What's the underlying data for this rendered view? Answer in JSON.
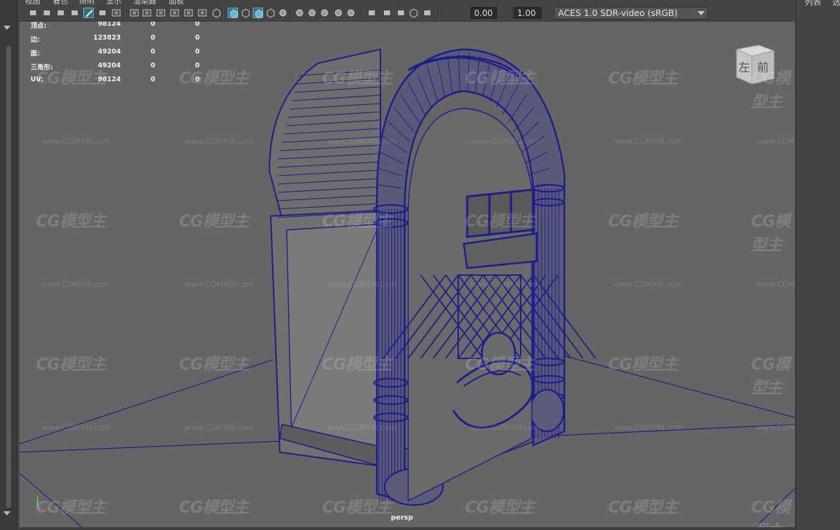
{
  "menubar": {
    "items": [
      "视图",
      "着色",
      "照明",
      "显示",
      "渲染器",
      "面板"
    ]
  },
  "toolbar": {
    "fields": {
      "exposure": "0.00",
      "gamma": "1.00"
    },
    "colorspace": {
      "selected": "ACES 1.0 SDR-video (sRGB)"
    },
    "icons": [
      "select-camera-icon",
      "camera-attributes-icon",
      "bookmark-icon",
      "image-plane-icon",
      "grease-pencil-icon",
      "2d-pan-zoom-icon",
      "grid-icon",
      "film-gate-icon",
      "resolution-gate-icon",
      "gate-mask-icon",
      "field-chart-icon",
      "safe-action-icon",
      "safe-title-icon",
      "wireframe-icon",
      "smooth-shade-icon",
      "default-material-icon",
      "wireframe-on-shaded-icon",
      "xray-icon",
      "lights-icon",
      "shadows-icon",
      "ambient-occlusion-icon",
      "motion-blur-icon",
      "anti-aliasing-icon",
      "depth-of-field-icon",
      "isolate-select-icon",
      "xray-joints-icon",
      "xray-active-icon",
      "backface-icon",
      "exposure-icon",
      "gamma-icon",
      "color-management-icon"
    ],
    "accent": "#5fb8d6"
  },
  "hud": {
    "rows": [
      {
        "label": "顶点:",
        "v1": "98124",
        "v2": "0",
        "v3": "0"
      },
      {
        "label": "边:",
        "v1": "123823",
        "v2": "0",
        "v3": "0"
      },
      {
        "label": "面:",
        "v1": "49204",
        "v2": "0",
        "v3": "0"
      },
      {
        "label": "三角形:",
        "v1": "49204",
        "v2": "0",
        "v3": "0"
      },
      {
        "label": "UV:",
        "v1": "98124",
        "v2": "0",
        "v3": "0"
      }
    ]
  },
  "viewport": {
    "camera": "persp",
    "background": "#656565",
    "wire_color": "#1c1f8a",
    "viewcube": {
      "left": "左",
      "front": "前"
    },
    "watermark": {
      "logo": "CG模型主",
      "url": "www.CGMXW.com"
    }
  },
  "right_panel": {
    "tabs": [
      "列表",
      "选"
    ]
  }
}
